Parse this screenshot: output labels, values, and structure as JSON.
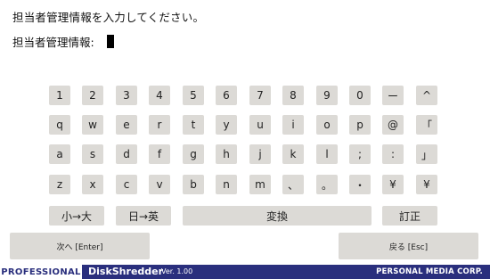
{
  "prompt": "担当者管理情報を入力してください。",
  "field": {
    "label": "担当者管理情報:",
    "value": ""
  },
  "keyboard": {
    "rows": [
      [
        "1",
        "2",
        "3",
        "4",
        "5",
        "6",
        "7",
        "8",
        "9",
        "0",
        "ー",
        "^"
      ],
      [
        "q",
        "w",
        "e",
        "r",
        "t",
        "y",
        "u",
        "i",
        "o",
        "p",
        "@",
        "「"
      ],
      [
        "a",
        "s",
        "d",
        "f",
        "g",
        "h",
        "j",
        "k",
        "l",
        ";",
        ":",
        "」"
      ],
      [
        "z",
        "x",
        "c",
        "v",
        "b",
        "n",
        "m",
        "、",
        "。",
        "・",
        "¥",
        "¥"
      ]
    ],
    "function_keys": {
      "small_large": "小→大",
      "jp_en": "日→英",
      "convert": "変換",
      "correct": "訂正"
    }
  },
  "buttons": {
    "next": "次へ [Enter]",
    "back": "戻る [Esc]"
  },
  "footer": {
    "brand": "PROFESSIONAL",
    "product": "DiskShredder",
    "version": "Ver. 1.00",
    "company": "PERSONAL MEDIA CORP."
  }
}
